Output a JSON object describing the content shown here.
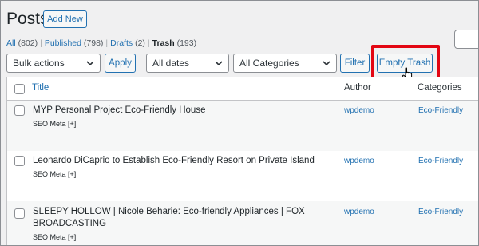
{
  "header": {
    "title": "Posts",
    "add_new_label": "Add New"
  },
  "status_links": [
    {
      "label": "All",
      "count": "(802)",
      "current": false
    },
    {
      "label": "Published",
      "count": "(798)",
      "current": false
    },
    {
      "label": "Drafts",
      "count": "(2)",
      "current": false
    },
    {
      "label": "Trash",
      "count": "(193)",
      "current": true
    }
  ],
  "filters": {
    "bulk_actions": "Bulk actions",
    "apply_label": "Apply",
    "dates": "All dates",
    "categories": "All Categories",
    "filter_label": "Filter",
    "empty_trash_label": "Empty Trash"
  },
  "table": {
    "columns": {
      "title": "Title",
      "author": "Author",
      "categories": "Categories"
    },
    "rows": [
      {
        "title": "MYP Personal Project Eco-Friendly House",
        "seo": "SEO Meta [+]",
        "author": "wpdemo",
        "category": "Eco-Friendly"
      },
      {
        "title": "Leonardo DiCaprio to Establish Eco-Friendly Resort on Private Island",
        "seo": "SEO Meta [+]",
        "author": "wpdemo",
        "category": "Eco-Friendly"
      },
      {
        "title": "SLEEPY HOLLOW | Nicole Beharie: Eco-friendly Appliances | FOX BROADCASTING",
        "seo": "SEO Meta [+]",
        "author": "wpdemo",
        "category": "Eco-Friendly"
      }
    ]
  },
  "colors": {
    "link": "#2271b1",
    "highlight": "#e30613",
    "background": "#f0f0f1"
  },
  "icons": [
    "chevron-down-icon",
    "hand-pointer-icon"
  ]
}
